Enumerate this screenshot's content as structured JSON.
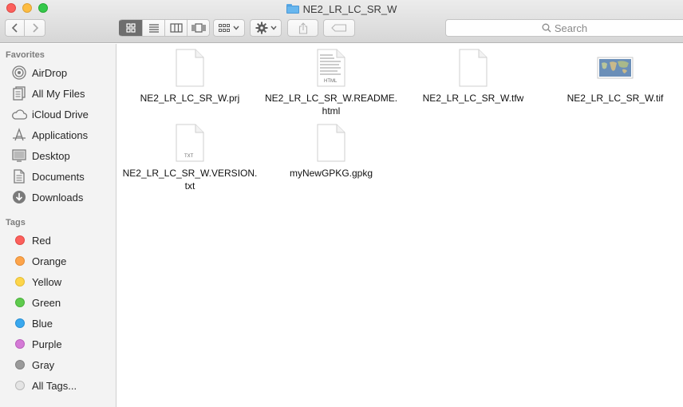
{
  "window": {
    "title": "NE2_LR_LC_SR_W"
  },
  "toolbar": {
    "back_icon": "chevron-left-icon",
    "forward_icon": "chevron-right-icon",
    "views": [
      "icon-view-icon",
      "list-view-icon",
      "column-view-icon",
      "cover-flow-icon"
    ],
    "search_placeholder": "Search"
  },
  "sidebar": {
    "favorites_header": "Favorites",
    "favorites": [
      {
        "label": "AirDrop",
        "icon": "airdrop-icon"
      },
      {
        "label": "All My Files",
        "icon": "all-files-icon"
      },
      {
        "label": "iCloud Drive",
        "icon": "cloud-icon"
      },
      {
        "label": "Applications",
        "icon": "applications-icon"
      },
      {
        "label": "Desktop",
        "icon": "desktop-icon"
      },
      {
        "label": "Documents",
        "icon": "documents-icon"
      },
      {
        "label": "Downloads",
        "icon": "downloads-icon"
      }
    ],
    "tags_header": "Tags",
    "tags": [
      {
        "label": "Red",
        "color": "#fc605c"
      },
      {
        "label": "Orange",
        "color": "#fda44a"
      },
      {
        "label": "Yellow",
        "color": "#fdd54a"
      },
      {
        "label": "Green",
        "color": "#5fcb4e"
      },
      {
        "label": "Blue",
        "color": "#3aa8ee"
      },
      {
        "label": "Purple",
        "color": "#d47ad6"
      },
      {
        "label": "Gray",
        "color": "#9a9a9a"
      },
      {
        "label": "All Tags...",
        "color": "#e4e4e4"
      }
    ]
  },
  "files": [
    {
      "name": "NE2_LR_LC_SR_W.prj",
      "kind": "blank",
      "badge": ""
    },
    {
      "name": "NE2_LR_LC_SR_W.README.html",
      "kind": "html",
      "badge": "HTML"
    },
    {
      "name": "NE2_LR_LC_SR_W.tfw",
      "kind": "blank",
      "badge": ""
    },
    {
      "name": "NE2_LR_LC_SR_W.tif",
      "kind": "image",
      "badge": ""
    },
    {
      "name": "NE2_LR_LC_SR_W.VERSION.txt",
      "kind": "txt",
      "badge": "TXT"
    },
    {
      "name": "myNewGPKG.gpkg",
      "kind": "blank",
      "badge": ""
    }
  ]
}
